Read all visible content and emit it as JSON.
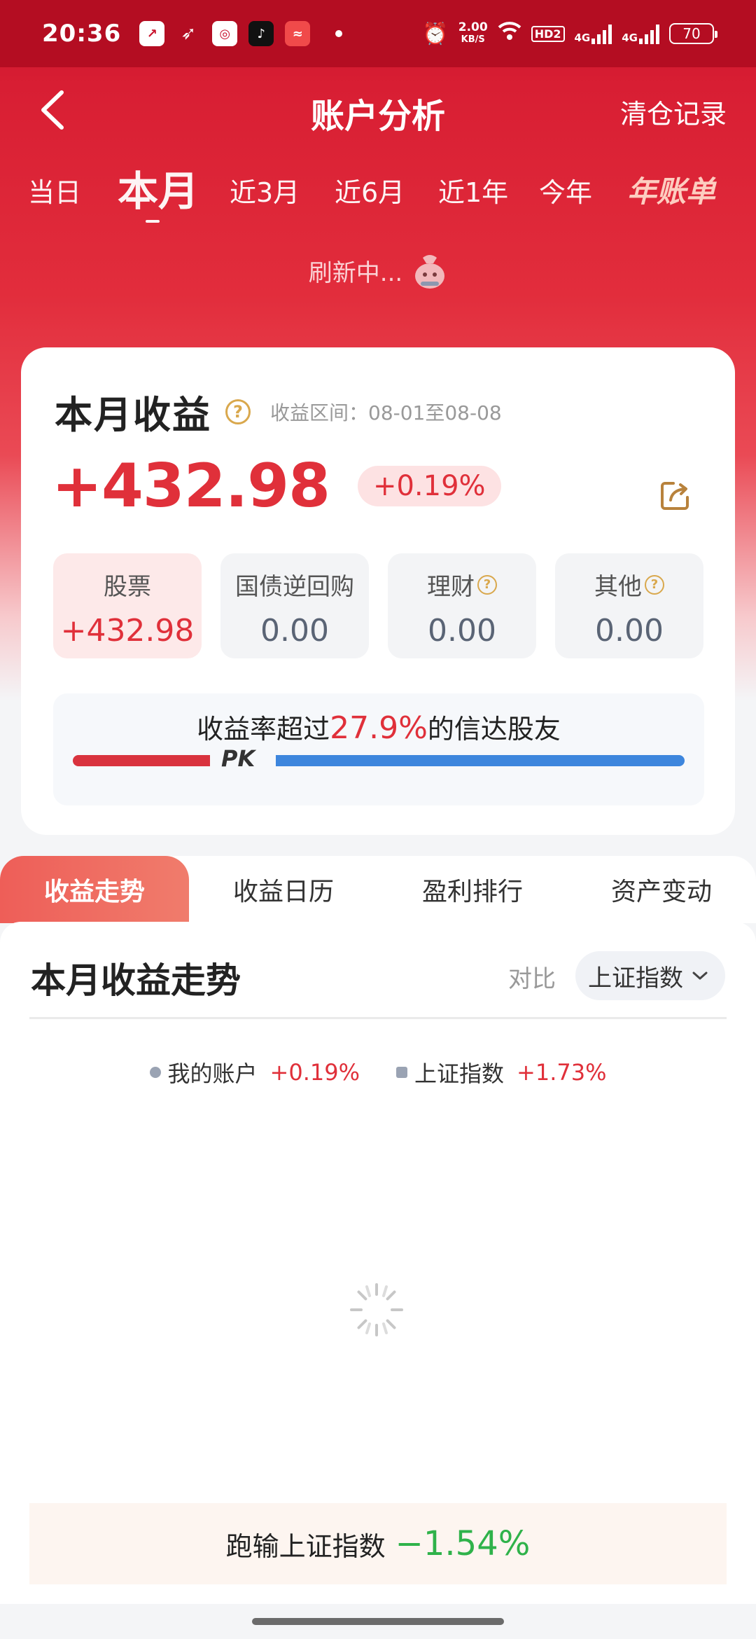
{
  "status_bar": {
    "time": "20:36",
    "speed_value": "2.00",
    "speed_unit": "KB/S",
    "hd_badge": "HD2",
    "net1": "4G",
    "net2": "4G",
    "battery": "70"
  },
  "header": {
    "title": "账户分析",
    "right_action": "清仓记录"
  },
  "periods": [
    "当日",
    "本月",
    "近3月",
    "近6月",
    "近1年",
    "今年",
    "年账单"
  ],
  "active_period": "本月",
  "refresh_text": "刷新中...",
  "summary": {
    "title": "本月收益",
    "range_label": "收益区间：08-01至08-08",
    "amount": "+432.98",
    "percent": "+0.19%"
  },
  "tiles": [
    {
      "label": "股票",
      "value": "+432.98"
    },
    {
      "label": "国债逆回购",
      "value": "0.00"
    },
    {
      "label": "理财",
      "value": "0.00"
    },
    {
      "label": "其他",
      "value": "0.00"
    }
  ],
  "pk": {
    "prefix": "收益率超过",
    "highlight": "27.9%",
    "suffix": "的信达股友",
    "label": "PK",
    "beat_fraction": 0.279
  },
  "tabs": [
    "收益走势",
    "收益日历",
    "盈利排行",
    "资产变动"
  ],
  "chart_panel": {
    "title": "本月收益走势",
    "compare_label": "对比",
    "compare_value": "上证指数",
    "legend": [
      {
        "name": "我的账户",
        "value": "+0.19%"
      },
      {
        "name": "上证指数",
        "value": "+1.73%"
      }
    ],
    "result_label": "跑输上证指数",
    "result_value": "−1.54%"
  },
  "colors": {
    "brand_red": "#c8102a",
    "gain_red": "#e0303a",
    "loss_green": "#2fb24a",
    "pk_blue": "#3d86dd"
  }
}
